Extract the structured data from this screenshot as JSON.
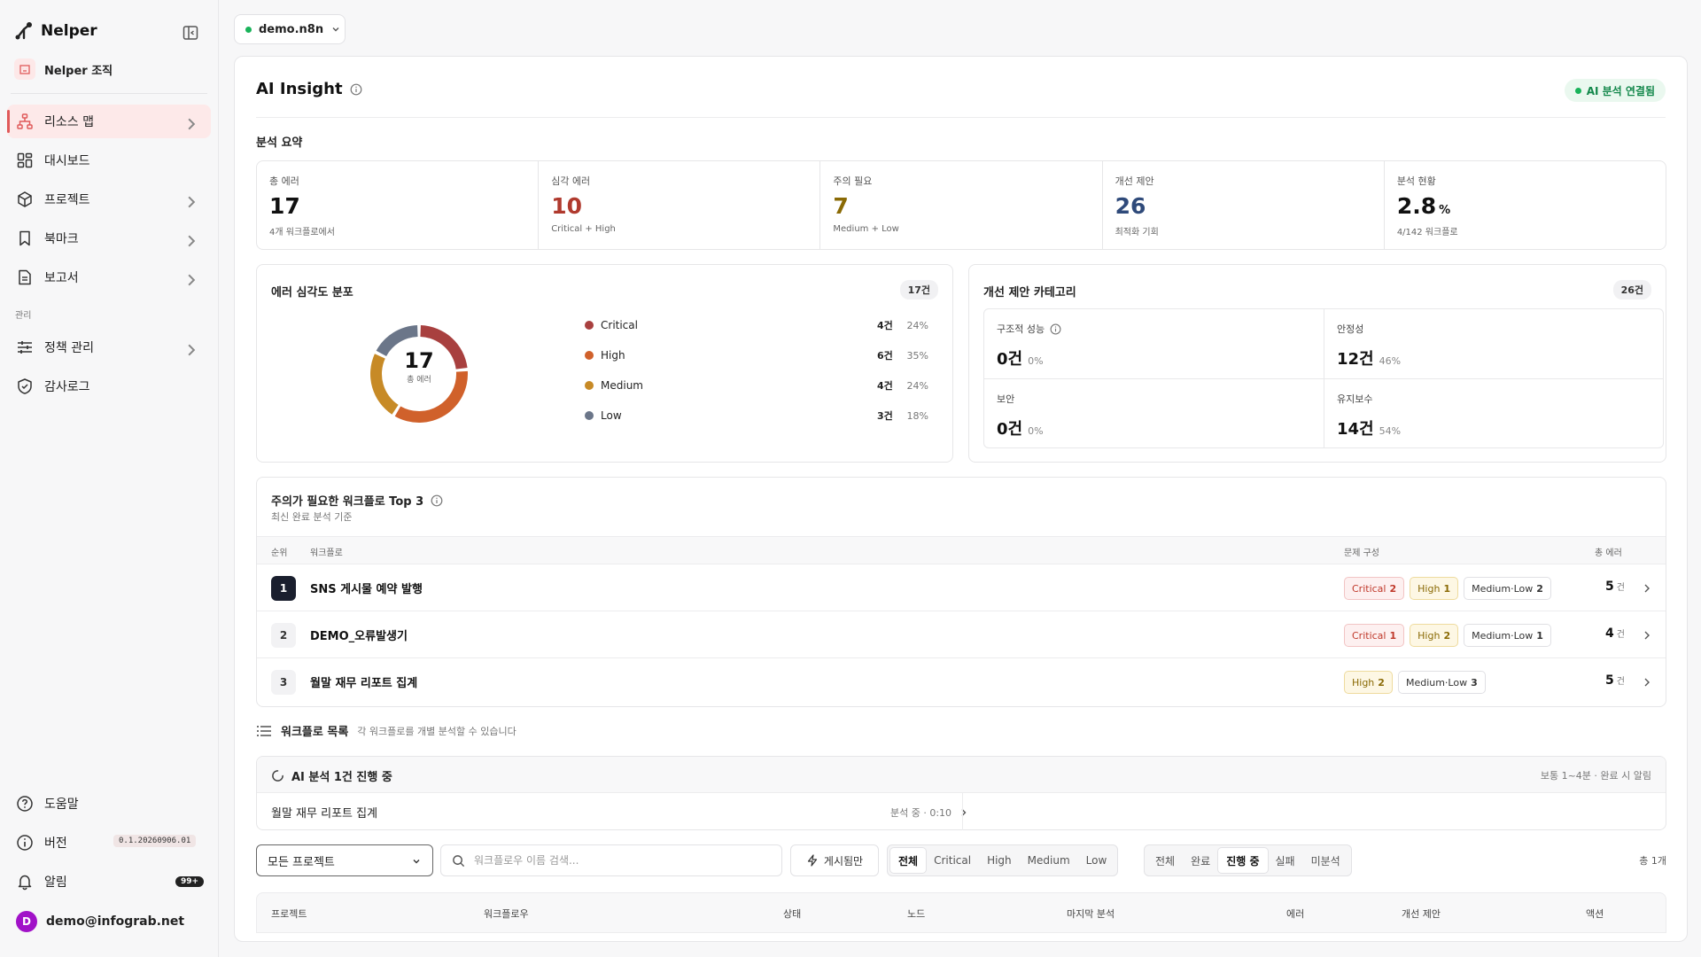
{
  "brand": {
    "name": "Nelper"
  },
  "org": {
    "name": "Nelper 조직"
  },
  "nav": {
    "items": [
      {
        "label": "리소스 맵"
      },
      {
        "label": "대시보드"
      },
      {
        "label": "프로젝트"
      },
      {
        "label": "북마크"
      },
      {
        "label": "보고서"
      }
    ],
    "section_label": "관리",
    "admin_items": [
      {
        "label": "정책 관리"
      },
      {
        "label": "감사로그"
      }
    ],
    "footer": {
      "help": "도움말",
      "version_label": "버전",
      "version_value": "0.1.20260906.01",
      "alerts_label": "알림",
      "alerts_badge": "99+",
      "avatar_letter": "D",
      "user_email": "demo@infograb.net"
    }
  },
  "domain": {
    "label": "demo.n8n"
  },
  "insight": {
    "title": "AI Insight",
    "status_badge": "AI 분석 연결됨",
    "summary_label": "분석 요약",
    "stats": [
      {
        "label": "총 에러",
        "value": "17",
        "unit": "",
        "sub": "4개 워크플로에서",
        "color": "#111111"
      },
      {
        "label": "심각 에러",
        "value": "10",
        "unit": "",
        "sub": "Critical + High",
        "color": "#b03a2e"
      },
      {
        "label": "주의 필요",
        "value": "7",
        "unit": "",
        "sub": "Medium + Low",
        "color": "#8a6a05"
      },
      {
        "label": "개선 제안",
        "value": "26",
        "unit": "",
        "sub": "최적화 기회",
        "color": "#2f4a7a"
      },
      {
        "label": "분석 현황",
        "value": "2.8",
        "unit": "%",
        "sub": "4/142 워크플로",
        "color": "#111111"
      }
    ]
  },
  "severity": {
    "title": "에러 심각도 분포",
    "count": "17건",
    "total": "17",
    "total_label": "총 에러",
    "items": [
      {
        "name": "Critical",
        "count": "4건",
        "pct": "24%",
        "value": 4,
        "color": "#a8403f"
      },
      {
        "name": "High",
        "count": "6건",
        "pct": "35%",
        "value": 6,
        "color": "#d0612b"
      },
      {
        "name": "Medium",
        "count": "4건",
        "pct": "24%",
        "value": 4,
        "color": "#c78a26"
      },
      {
        "name": "Low",
        "count": "3건",
        "pct": "18%",
        "value": 3,
        "color": "#6b7689"
      }
    ]
  },
  "categories": {
    "title": "개선 제안 카테고리",
    "count": "26건",
    "items": [
      {
        "name": "구조적 성능",
        "value": "0건",
        "pct": "0%"
      },
      {
        "name": "안정성",
        "value": "12건",
        "pct": "46%"
      },
      {
        "name": "보안",
        "value": "0건",
        "pct": "0%"
      },
      {
        "name": "유지보수",
        "value": "14건",
        "pct": "54%"
      }
    ]
  },
  "top3": {
    "title": "주의가 필요한 워크플로 Top 3",
    "subtitle": "최신 완료 분석 기준",
    "headers": {
      "rank": "순위",
      "workflow": "워크플로",
      "issues": "문제 구성",
      "total": "총 에러"
    },
    "unit": "건",
    "rows": [
      {
        "rank": "1",
        "name": "SNS 게시물 예약 발행",
        "total": "5",
        "tags": [
          {
            "type": "crit",
            "label": "Critical",
            "n": "2"
          },
          {
            "type": "high",
            "label": "High",
            "n": "1"
          },
          {
            "type": "ml",
            "label": "Medium·Low",
            "n": "2"
          }
        ]
      },
      {
        "rank": "2",
        "name": "DEMO_오류발생기",
        "total": "4",
        "tags": [
          {
            "type": "crit",
            "label": "Critical",
            "n": "1"
          },
          {
            "type": "high",
            "label": "High",
            "n": "2"
          },
          {
            "type": "ml",
            "label": "Medium·Low",
            "n": "1"
          }
        ]
      },
      {
        "rank": "3",
        "name": "월말 재무 리포트 집계",
        "total": "5",
        "tags": [
          {
            "type": "high",
            "label": "High",
            "n": "2"
          },
          {
            "type": "ml",
            "label": "Medium·Low",
            "n": "3"
          }
        ]
      }
    ]
  },
  "workflow_list": {
    "title": "워크플로 목록",
    "subtitle": "각 워크플로를 개별 분석할 수 있습니다",
    "progress": {
      "title": "AI 분석 1건 진행 중",
      "note": "보통 1~4분 · 완료 시 알림",
      "item_name": "월말 재무 리포트 집계",
      "item_status": "분석 중 · 0:10"
    },
    "filters": {
      "project_select": "모든 프로젝트",
      "search_placeholder": "워크플로우 이름 검색...",
      "published_only": "게시됨만",
      "severity": [
        "전체",
        "Critical",
        "High",
        "Medium",
        "Low"
      ],
      "severity_selected": 0,
      "status": [
        "전체",
        "완료",
        "진행 중",
        "실패",
        "미분석"
      ],
      "status_selected": 2,
      "total": "총 1개"
    },
    "columns": [
      "프로젝트",
      "워크플로우",
      "상태",
      "노드",
      "마지막 분석",
      "에러",
      "개선 제안",
      "액션"
    ]
  }
}
